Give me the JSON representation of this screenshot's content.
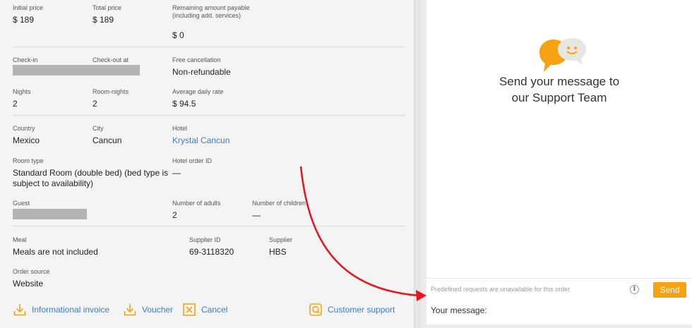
{
  "booking": {
    "initial_price_label": "Initial price",
    "initial_price": "$ 189",
    "total_price_label": "Total price",
    "total_price": "$ 189",
    "remaining_label": "Remaining amount payable (including add. services)",
    "remaining": "$ 0",
    "checkin_label": "Check-in",
    "checkout_label": "Check-out at",
    "free_cancel_label": "Free cancellation",
    "free_cancel": "Non-refundable",
    "nights_label": "Nights",
    "nights": "2",
    "room_nights_label": "Room-nights",
    "room_nights": "2",
    "adr_label": "Average daily rate",
    "adr": "$ 94.5",
    "country_label": "Country",
    "country": "Mexico",
    "city_label": "City",
    "city": "Cancun",
    "hotel_label": "Hotel",
    "hotel": "Krystal Cancun",
    "room_type_label": "Room type",
    "room_type": "Standard Room (double bed) (bed type is subject to availability)",
    "hotel_order_id_label": "Hotel order ID",
    "hotel_order_id": "—",
    "guest_label": "Guest",
    "adults_label": "Number of adults",
    "adults": "2",
    "children_label": "Number of children",
    "children": "—",
    "meal_label": "Meal",
    "meal": "Meals are not included",
    "supplier_id_label": "Supplier ID",
    "supplier_id": "69-3118320",
    "supplier_label": "Supplier",
    "supplier": "HBS",
    "order_source_label": "Order source",
    "order_source": "Website"
  },
  "actions": {
    "invoice": "Informational invoice",
    "voucher": "Voucher",
    "cancel": "Cancel",
    "support": "Customer support"
  },
  "chat": {
    "title_line1": "Send your message to",
    "title_line2": "our Support Team",
    "predefined_note": "Predefined requests are unavailable for this order",
    "info_glyph": "i",
    "send_label": "Send",
    "message_label": "Your message:"
  },
  "colors": {
    "accent_orange": "#f5a313",
    "link_blue": "#3a7bd5",
    "annotation_red": "#e8141b"
  },
  "icons": [
    "download-icon",
    "cancel-box-icon",
    "support-chat-icon",
    "chat-bubbles-icon",
    "info-icon"
  ]
}
